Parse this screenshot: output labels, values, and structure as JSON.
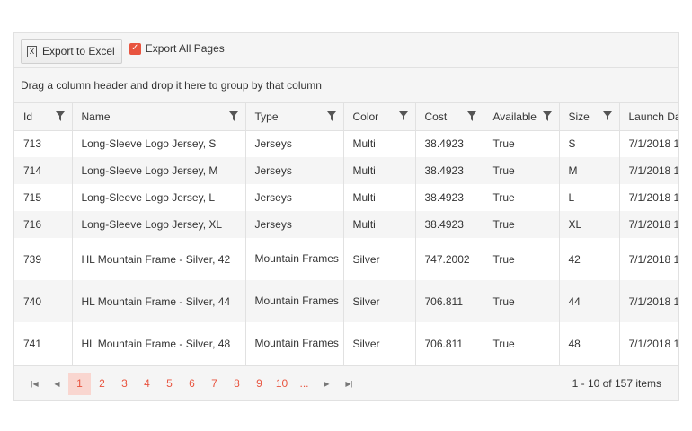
{
  "toolbar": {
    "export_label": "Export to Excel",
    "export_icon": "excel-icon",
    "export_all_label": "Export All Pages",
    "export_all_checked": true
  },
  "grouping": {
    "hint": "Drag a column header and drop it here to group by that column"
  },
  "columns": [
    "Id",
    "Name",
    "Type",
    "Color",
    "Cost",
    "Available",
    "Size",
    "Launch Date"
  ],
  "rows": [
    [
      "713",
      "Long-Sleeve Logo Jersey, S",
      "Jerseys",
      "Multi",
      "38.4923",
      "True",
      "S",
      "7/1/2018 1"
    ],
    [
      "714",
      "Long-Sleeve Logo Jersey, M",
      "Jerseys",
      "Multi",
      "38.4923",
      "True",
      "M",
      "7/1/2018 1"
    ],
    [
      "715",
      "Long-Sleeve Logo Jersey, L",
      "Jerseys",
      "Multi",
      "38.4923",
      "True",
      "L",
      "7/1/2018 1"
    ],
    [
      "716",
      "Long-Sleeve Logo Jersey, XL",
      "Jerseys",
      "Multi",
      "38.4923",
      "True",
      "XL",
      "7/1/2018 1"
    ],
    [
      "739",
      "HL Mountain Frame - Silver, 42",
      "Mountain Frames",
      "Silver",
      "747.2002",
      "True",
      "42",
      "7/1/2018 1"
    ],
    [
      "740",
      "HL Mountain Frame - Silver, 44",
      "Mountain Frames",
      "Silver",
      "706.811",
      "True",
      "44",
      "7/1/2018 1"
    ],
    [
      "741",
      "HL Mountain Frame - Silver, 48",
      "Mountain Frames",
      "Silver",
      "706.811",
      "True",
      "48",
      "7/1/2018 1"
    ]
  ],
  "pager": {
    "pages": [
      "1",
      "2",
      "3",
      "4",
      "5",
      "6",
      "7",
      "8",
      "9",
      "10",
      "..."
    ],
    "current_page": "1",
    "info": "1 - 10 of 157 items"
  },
  "colors": {
    "accent": "#e8543f",
    "active_page_bg": "#f9d6d0",
    "header_bg": "#f5f5f5",
    "border": "#e1e1e1"
  }
}
